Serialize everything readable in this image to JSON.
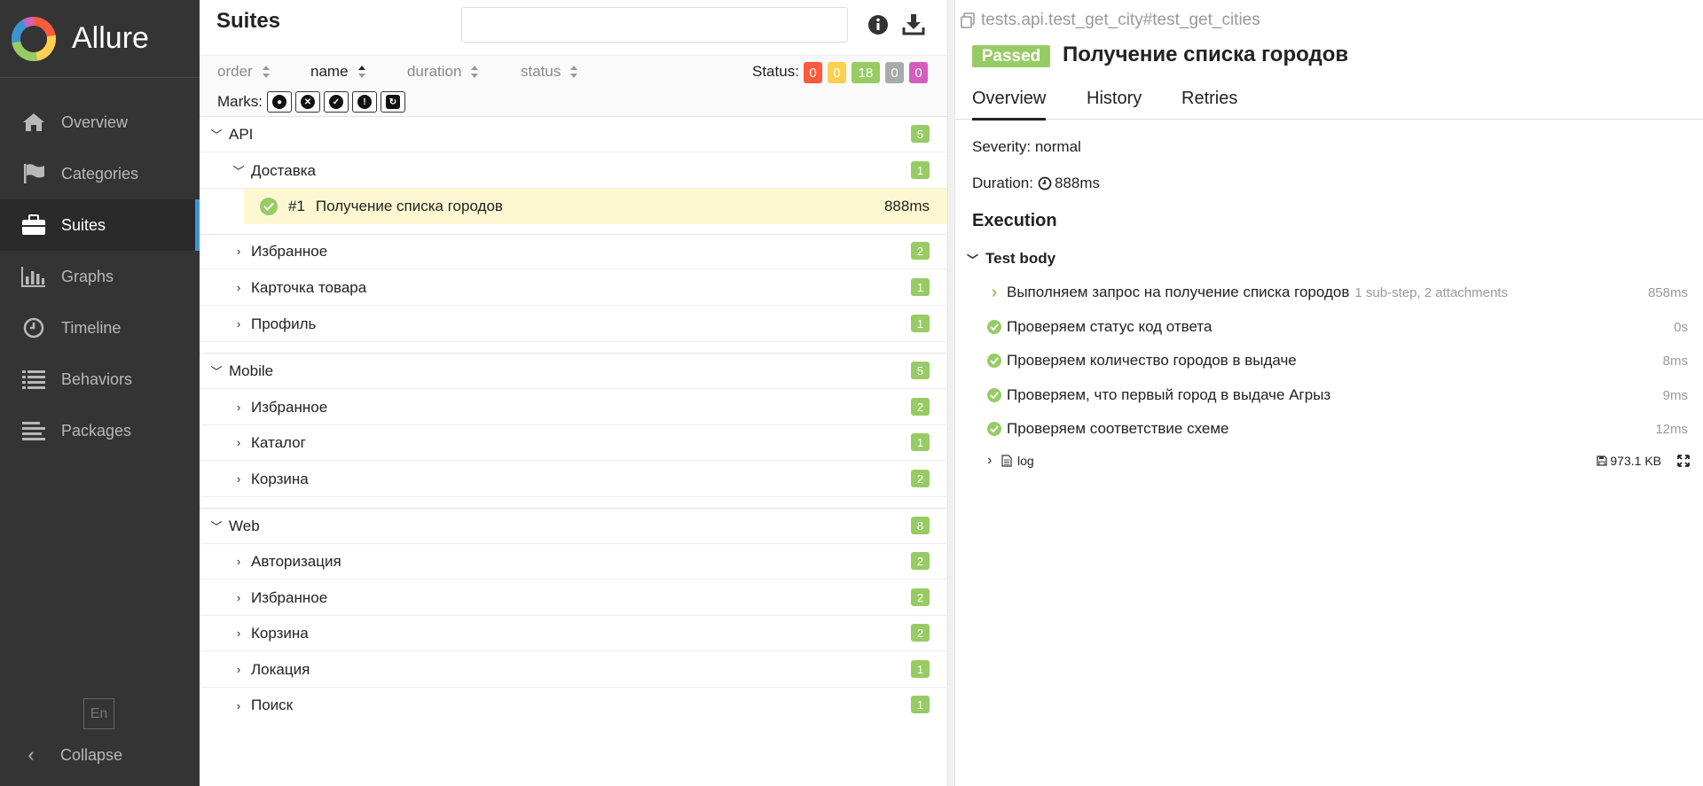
{
  "app": {
    "name": "Allure"
  },
  "sidebar": {
    "items": [
      {
        "label": "Overview",
        "icon": "home-icon"
      },
      {
        "label": "Categories",
        "icon": "flag-icon"
      },
      {
        "label": "Suites",
        "icon": "briefcase-icon",
        "active": true
      },
      {
        "label": "Graphs",
        "icon": "bar-chart-icon"
      },
      {
        "label": "Timeline",
        "icon": "clock-icon"
      },
      {
        "label": "Behaviors",
        "icon": "list-icon"
      },
      {
        "label": "Packages",
        "icon": "align-left-icon"
      }
    ],
    "lang": "En",
    "collapse_label": "Collapse"
  },
  "suites": {
    "title": "Suites",
    "search": {
      "value": "",
      "placeholder": ""
    },
    "sort": {
      "order": "order",
      "name": "name",
      "duration": "duration",
      "status": "status"
    },
    "status_label": "Status:",
    "status_counts": [
      {
        "value": "0",
        "color": "#fd5a3e"
      },
      {
        "value": "0",
        "color": "#ffd050"
      },
      {
        "value": "18",
        "color": "#97cc64"
      },
      {
        "value": "0",
        "color": "#aaaaaa"
      },
      {
        "value": "0",
        "color": "#d35ebe"
      }
    ],
    "marks_label": "Marks:",
    "tree": {
      "api": {
        "label": "API",
        "count": "5"
      },
      "delivery": {
        "label": "Доставка",
        "count": "1"
      },
      "test": {
        "num": "#1",
        "label": "Получение списка городов",
        "duration": "888ms"
      },
      "api_fav": {
        "label": "Избранное",
        "count": "2"
      },
      "api_card": {
        "label": "Карточка товара",
        "count": "1"
      },
      "api_profile": {
        "label": "Профиль",
        "count": "1"
      },
      "mobile": {
        "label": "Mobile",
        "count": "5"
      },
      "mob_fav": {
        "label": "Избранное",
        "count": "2"
      },
      "mob_catalog": {
        "label": "Каталог",
        "count": "1"
      },
      "mob_cart": {
        "label": "Корзина",
        "count": "2"
      },
      "web": {
        "label": "Web",
        "count": "8"
      },
      "web_auth": {
        "label": "Авторизация",
        "count": "2"
      },
      "web_fav": {
        "label": "Избранное",
        "count": "2"
      },
      "web_cart": {
        "label": "Корзина",
        "count": "2"
      },
      "web_loc": {
        "label": "Локация",
        "count": "1"
      },
      "web_search": {
        "label": "Поиск",
        "count": "1"
      }
    }
  },
  "detail": {
    "path": "tests.api.test_get_city#test_get_cities",
    "status": "Passed",
    "title": "Получение списка городов",
    "tabs": {
      "overview": "Overview",
      "history": "History",
      "retries": "Retries"
    },
    "severity": "Severity: normal",
    "duration_label": "Duration:",
    "duration": "888ms",
    "execution_title": "Execution",
    "test_body": "Test body",
    "steps": [
      {
        "label": "Выполняем запрос на получение списка городов",
        "sub": "1 sub-step, 2 attachments",
        "time": "858ms"
      },
      {
        "label": "Проверяем статус код ответа",
        "time": "0s"
      },
      {
        "label": "Проверяем количество городов в выдаче",
        "time": "8ms"
      },
      {
        "label": "Проверяем, что первый город в выдаче Агрыз",
        "time": "9ms"
      },
      {
        "label": "Проверяем соответствие схеме",
        "time": "12ms"
      }
    ],
    "attachment": {
      "name": "log",
      "size": "973.1 KB"
    }
  }
}
